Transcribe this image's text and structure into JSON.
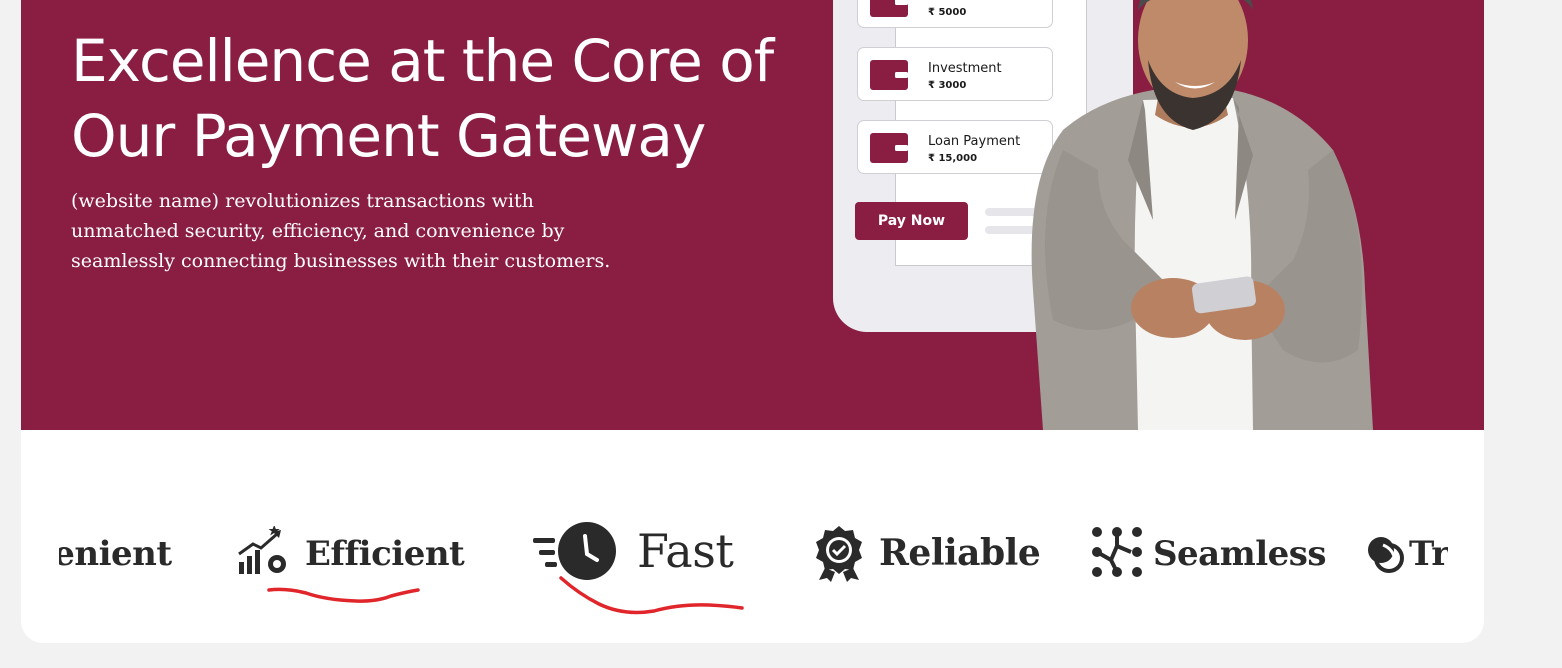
{
  "hero": {
    "title_line1": "Excellence at the Core of",
    "title_line2": "Our Payment Gateway",
    "description": "(website name) revolutionizes transactions with unmatched security, efficiency, and convenience by seamlessly connecting businesses with their customers."
  },
  "phone": {
    "cards": [
      {
        "name": "",
        "amount": "₹ 5000"
      },
      {
        "name": "Investment",
        "amount": "₹ 3000"
      },
      {
        "name": "Loan Payment",
        "amount": "₹ 15,000"
      }
    ],
    "pay_button": "Pay Now"
  },
  "features": [
    {
      "label": "Convenient",
      "icon": "convenient-icon"
    },
    {
      "label": "Efficient",
      "icon": "growth-gear-icon"
    },
    {
      "label": "Fast",
      "icon": "fast-clock-icon"
    },
    {
      "label": "Reliable",
      "icon": "badge-check-icon"
    },
    {
      "label": "Seamless",
      "icon": "network-nodes-icon"
    },
    {
      "label": "Transparent",
      "icon": "overlap-circles-icon"
    }
  ],
  "colors": {
    "brand": "#8a1e42",
    "annotation": "#e0262b",
    "text_dark": "#2a2a2a"
  }
}
